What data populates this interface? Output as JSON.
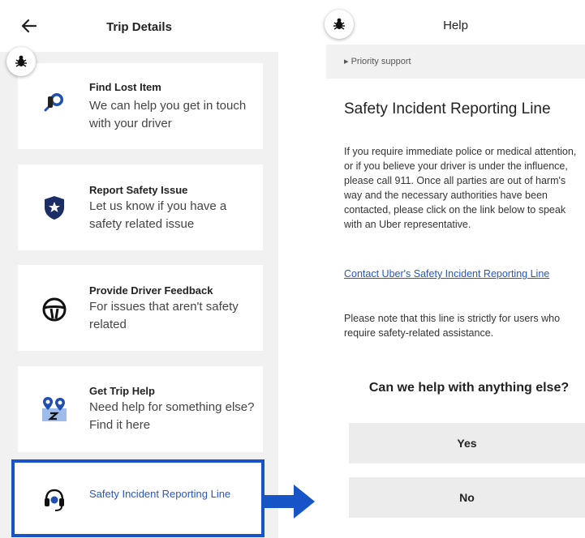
{
  "left_panel": {
    "title": "Trip Details",
    "cards": [
      {
        "title": "Find Lost Item",
        "description": "We can help you get in touch with your driver",
        "icon": "lost-item-icon"
      },
      {
        "title": "Report Safety Issue",
        "description": "Let us know if you have a safety related issue",
        "icon": "shield-star-icon"
      },
      {
        "title": "Provide Driver Feedback",
        "description": "For issues that aren't safety related",
        "icon": "steering-wheel-icon"
      },
      {
        "title": "Get Trip Help",
        "description": "Need help for something else? Find it here",
        "icon": "map-pin-icon"
      },
      {
        "title": "Safety Incident Reporting Line",
        "icon": "headset-icon"
      }
    ]
  },
  "right_panel": {
    "title": "Help",
    "breadcrumb": "Priority support",
    "heading": "Safety Incident Reporting Line",
    "body": "If you require immediate police or medical attention, or if you believe your driver is under the influence, please call 911. Once all parties are out of harm's way and the necessary authorities have been contacted, please click on the link below to speak with an Uber representative.",
    "link": "Contact Uber's Safety Incident Reporting Line",
    "note": "Please note that this line is strictly for users who require safety-related assistance.",
    "question": "Can we help with anything else?",
    "yes_label": "Yes",
    "no_label": "No"
  },
  "colors": {
    "highlight": "#1654c8",
    "link": "#2457c5",
    "icon_blue": "#1f4fb0",
    "panel_bg": "#f1f1f1"
  }
}
